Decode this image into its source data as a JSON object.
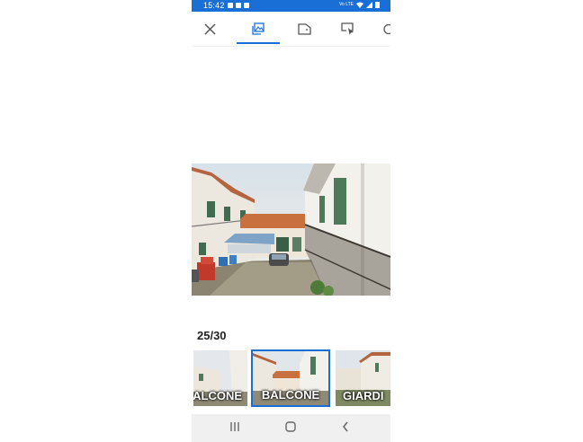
{
  "status_bar": {
    "time": "15:42",
    "network_text": "Vo LTE",
    "background": "#1a6fd6"
  },
  "toolbar": {
    "tabs": [
      {
        "name": "close",
        "icon": "close-icon"
      },
      {
        "name": "photos",
        "icon": "photo-gallery-icon",
        "active": true
      },
      {
        "name": "floor-plan",
        "icon": "floor-plan-icon"
      },
      {
        "name": "virtual-tour",
        "icon": "cursor-tour-icon"
      },
      {
        "name": "more",
        "icon": "partial-icon"
      }
    ],
    "accent": "#1a6fd6"
  },
  "gallery": {
    "counter": "25/30",
    "thumbnails": [
      {
        "label": "ALCONE"
      },
      {
        "label": "BALCONE",
        "selected": true
      },
      {
        "label": "GIARDI"
      }
    ]
  },
  "system_nav": {
    "buttons": [
      "recents-icon",
      "home-icon",
      "back-icon"
    ]
  }
}
